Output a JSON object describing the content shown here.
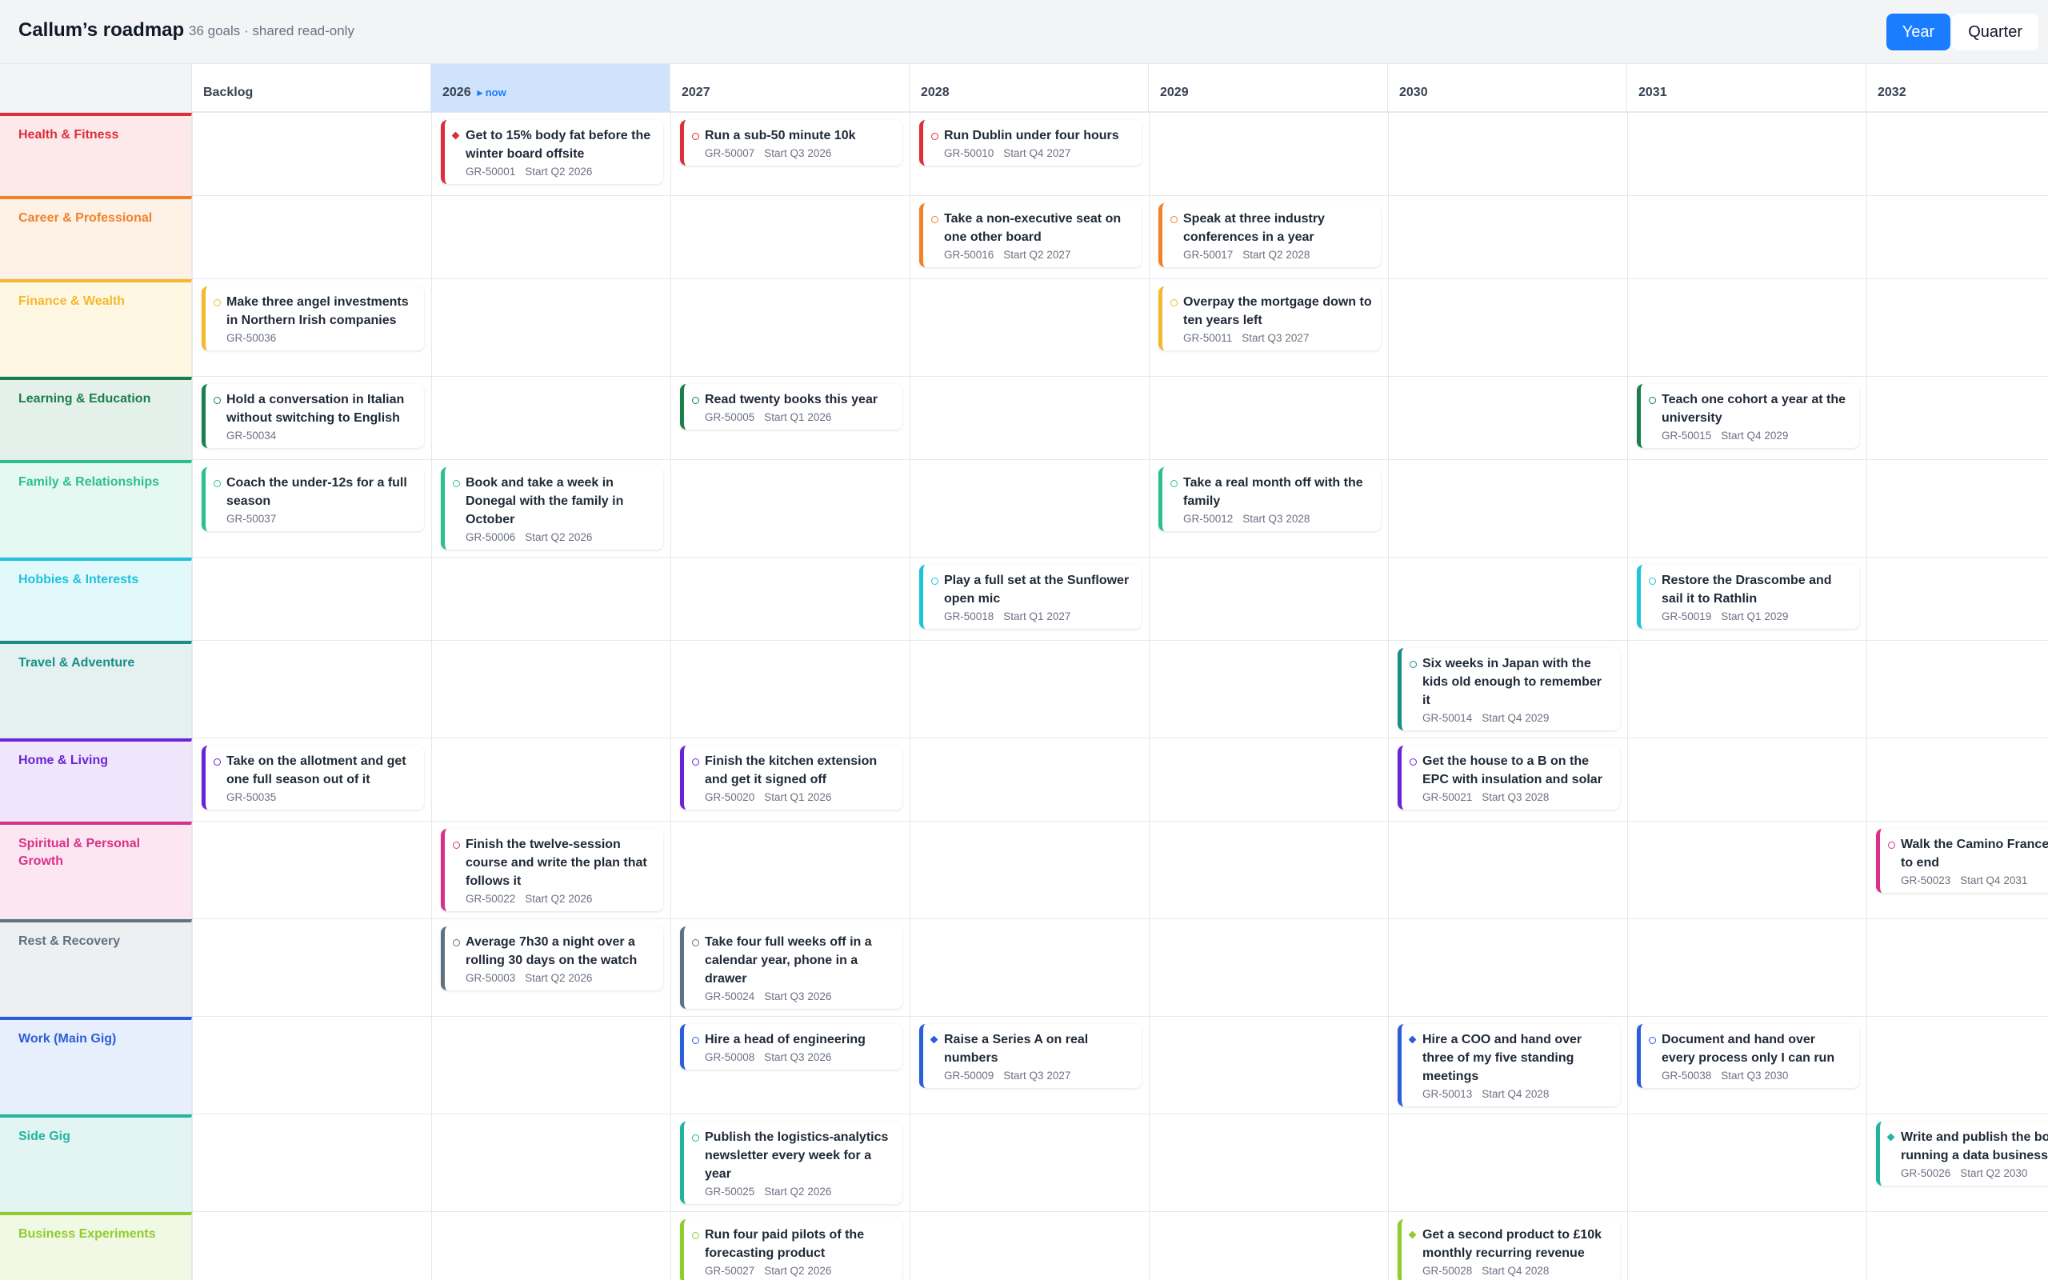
{
  "header": {
    "title": "Callum’s roadmap",
    "subtitle": "36 goals · shared read-only",
    "views": [
      {
        "label": "Year",
        "active": true
      },
      {
        "label": "Quarter",
        "active": false
      }
    ]
  },
  "columns": [
    {
      "label": "Backlog",
      "now": false
    },
    {
      "label": "2026",
      "now": true,
      "now_label": "▸ now"
    },
    {
      "label": "2027",
      "now": false
    },
    {
      "label": "2028",
      "now": false
    },
    {
      "label": "2029",
      "now": false
    },
    {
      "label": "2030",
      "now": false
    },
    {
      "label": "2031",
      "now": false
    },
    {
      "label": "2032",
      "now": false
    }
  ],
  "rows": [
    {
      "label": "Health & Fitness",
      "color": "#dc2f3a",
      "bg": "#fde9ea",
      "cards": [
        {
          "col": 1,
          "title": "Get to 15% body fat before the winter board offsite",
          "id": "GR-50001",
          "start": "Start Q2 2026",
          "status": "active"
        },
        {
          "col": 2,
          "title": "Run a sub-50 minute 10k",
          "id": "GR-50007",
          "start": "Start Q3 2026",
          "status": "open"
        },
        {
          "col": 3,
          "title": "Run Dublin under four hours",
          "id": "GR-50010",
          "start": "Start Q4 2027",
          "status": "open"
        }
      ]
    },
    {
      "label": "Career & Professional",
      "color": "#f0832a",
      "bg": "#fef1e6",
      "cards": [
        {
          "col": 3,
          "title": "Take a non-executive seat on one other board",
          "id": "GR-50016",
          "start": "Start Q2 2027",
          "status": "open"
        },
        {
          "col": 4,
          "title": "Speak at three industry conferences in a year",
          "id": "GR-50017",
          "start": "Start Q2 2028",
          "status": "open"
        }
      ]
    },
    {
      "label": "Finance & Wealth",
      "color": "#f5b82e",
      "bg": "#fef8e3",
      "cards": [
        {
          "col": 0,
          "title": "Make three angel investments in Northern Irish companies",
          "id": "GR-50036",
          "start": "",
          "status": "open"
        },
        {
          "col": 4,
          "title": "Overpay the mortgage down to ten years left",
          "id": "GR-50011",
          "start": "Start Q3 2027",
          "status": "open"
        }
      ]
    },
    {
      "label": "Learning & Education",
      "color": "#1a7f4b",
      "bg": "#e4f0ea",
      "cards": [
        {
          "col": 0,
          "title": "Hold a conversation in Italian without switching to English",
          "id": "GR-50034",
          "start": "",
          "status": "open"
        },
        {
          "col": 2,
          "title": "Read twenty books this year",
          "id": "GR-50005",
          "start": "Start Q1 2026",
          "status": "open"
        },
        {
          "col": 6,
          "title": "Teach one cohort a year at the university",
          "id": "GR-50015",
          "start": "Start Q4 2029",
          "status": "open"
        }
      ]
    },
    {
      "label": "Family & Relationships",
      "color": "#2ebf8f",
      "bg": "#e5f8f1",
      "cards": [
        {
          "col": 0,
          "title": "Coach the under-12s for a full season",
          "id": "GR-50037",
          "start": "",
          "status": "open"
        },
        {
          "col": 1,
          "title": "Book and take a week in Donegal with the family in October",
          "id": "GR-50006",
          "start": "Start Q2 2026",
          "status": "open"
        },
        {
          "col": 4,
          "title": "Take a real month off with the family",
          "id": "GR-50012",
          "start": "Start Q3 2028",
          "status": "open"
        }
      ]
    },
    {
      "label": "Hobbies & Interests",
      "color": "#1fc2de",
      "bg": "#e2f9fc",
      "cards": [
        {
          "col": 3,
          "title": "Play a full set at the Sunflower open mic",
          "id": "GR-50018",
          "start": "Start Q1 2027",
          "status": "open"
        },
        {
          "col": 6,
          "title": "Restore the Drascombe and sail it to Rathlin",
          "id": "GR-50019",
          "start": "Start Q1 2029",
          "status": "open"
        }
      ]
    },
    {
      "label": "Travel & Adventure",
      "color": "#178f86",
      "bg": "#e3f1f0",
      "cards": [
        {
          "col": 5,
          "title": "Six weeks in Japan with the kids old enough to remember it",
          "id": "GR-50014",
          "start": "Start Q4 2029",
          "status": "open"
        }
      ]
    },
    {
      "label": "Home & Living",
      "color": "#6a24d6",
      "bg": "#efe6fb",
      "cards": [
        {
          "col": 0,
          "title": "Take on the allotment and get one full season out of it",
          "id": "GR-50035",
          "start": "",
          "status": "open"
        },
        {
          "col": 2,
          "title": "Finish the kitchen extension and get it signed off",
          "id": "GR-50020",
          "start": "Start Q1 2026",
          "status": "open"
        },
        {
          "col": 5,
          "title": "Get the house to a B on the EPC with insulation and solar",
          "id": "GR-50021",
          "start": "Start Q3 2028",
          "status": "open"
        }
      ]
    },
    {
      "label": "Spiritual & Personal Growth",
      "color": "#d9318a",
      "bg": "#fce6f1",
      "cards": [
        {
          "col": 1,
          "title": "Finish the twelve-session course and write the plan that follows it",
          "id": "GR-50022",
          "start": "Start Q2 2026",
          "status": "open"
        },
        {
          "col": 7,
          "title": "Walk the Camino Frances end to end",
          "id": "GR-50023",
          "start": "Start Q4 2031",
          "status": "open"
        }
      ]
    },
    {
      "label": "Rest & Recovery",
      "color": "#5f7282",
      "bg": "#edeff1",
      "cards": [
        {
          "col": 1,
          "title": "Average 7h30 a night over a rolling 30 days on the watch",
          "id": "GR-50003",
          "start": "Start Q2 2026",
          "status": "open"
        },
        {
          "col": 2,
          "title": "Take four full weeks off in a calendar year, phone in a drawer",
          "id": "GR-50024",
          "start": "Start Q3 2026",
          "status": "open"
        }
      ]
    },
    {
      "label": "Work (Main Gig)",
      "color": "#2b5fd9",
      "bg": "#e7eefc",
      "cards": [
        {
          "col": 2,
          "title": "Hire a head of engineering",
          "id": "GR-50008",
          "start": "Start Q3 2026",
          "status": "open"
        },
        {
          "col": 3,
          "title": "Raise a Series A on real numbers",
          "id": "GR-50009",
          "start": "Start Q3 2027",
          "status": "active"
        },
        {
          "col": 5,
          "title": "Hire a COO and hand over three of my five standing meetings",
          "id": "GR-50013",
          "start": "Start Q4 2028",
          "status": "active"
        },
        {
          "col": 6,
          "title": "Document and hand over every process only I can run",
          "id": "GR-50038",
          "start": "Start Q3 2030",
          "status": "open"
        }
      ]
    },
    {
      "label": "Side Gig",
      "color": "#1fb59f",
      "bg": "#e3f5f2",
      "cards": [
        {
          "col": 2,
          "title": "Publish the logistics-analytics newsletter every week for a year",
          "id": "GR-50025",
          "start": "Start Q2 2026",
          "status": "open"
        },
        {
          "col": 7,
          "title": "Write and publish the book on running a data business",
          "id": "GR-50026",
          "start": "Start Q2 2030",
          "status": "active"
        }
      ]
    },
    {
      "label": "Business Experiments",
      "color": "#8fcc2e",
      "bg": "#f1f9e4",
      "cards": [
        {
          "col": 2,
          "title": "Run four paid pilots of the forecasting product",
          "id": "GR-50027",
          "start": "Start Q2 2026",
          "status": "open"
        },
        {
          "col": 5,
          "title": "Get a second product to £10k monthly recurring revenue",
          "id": "GR-50028",
          "start": "Start Q4 2028",
          "status": "active"
        }
      ]
    }
  ]
}
